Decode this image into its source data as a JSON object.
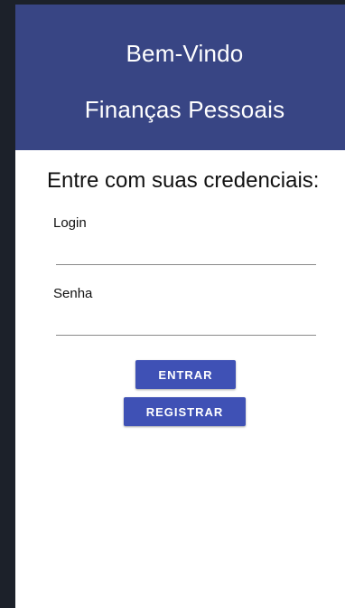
{
  "header": {
    "title": "Bem-Vindo",
    "subtitle": "Finanças Pessoais",
    "background_color": "#384584"
  },
  "form": {
    "prompt": "Entre com suas credenciais:",
    "login_label": "Login",
    "login_value": "",
    "password_label": "Senha",
    "password_value": ""
  },
  "buttons": {
    "login_label": "ENTRAR",
    "register_label": "REGISTRAR",
    "color": "#3f51b5"
  }
}
